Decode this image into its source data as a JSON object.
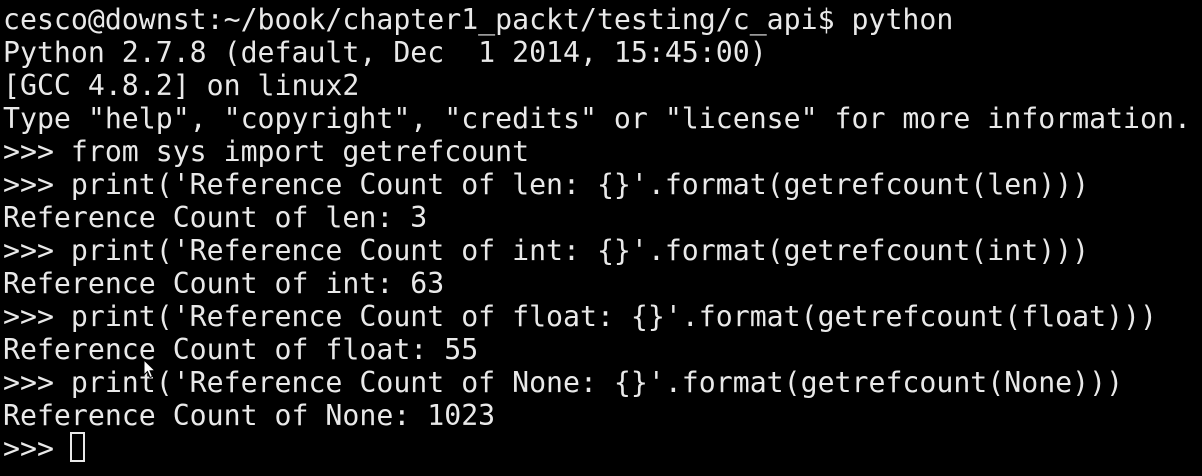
{
  "terminal": {
    "lines": [
      "cesco@downst:~/book/chapter1_packt/testing/c_api$ python",
      "Python 2.7.8 (default, Dec  1 2014, 15:45:00)",
      "[GCC 4.8.2] on linux2",
      "Type \"help\", \"copyright\", \"credits\" or \"license\" for more information.",
      ">>> from sys import getrefcount",
      ">>> print('Reference Count of len: {}'.format(getrefcount(len)))",
      "Reference Count of len: 3",
      ">>> print('Reference Count of int: {}'.format(getrefcount(int)))",
      "Reference Count of int: 63",
      ">>> print('Reference Count of float: {}'.format(getrefcount(float)))",
      "Reference Count of float: 55",
      ">>> print('Reference Count of None: {}'.format(getrefcount(None)))",
      "Reference Count of None: 1023",
      ">>> "
    ]
  },
  "colors": {
    "background": "#000000",
    "foreground": "#e9e9e9"
  },
  "icons": {
    "cursor": "block-cursor-icon",
    "pointer": "mouse-pointer-icon"
  }
}
